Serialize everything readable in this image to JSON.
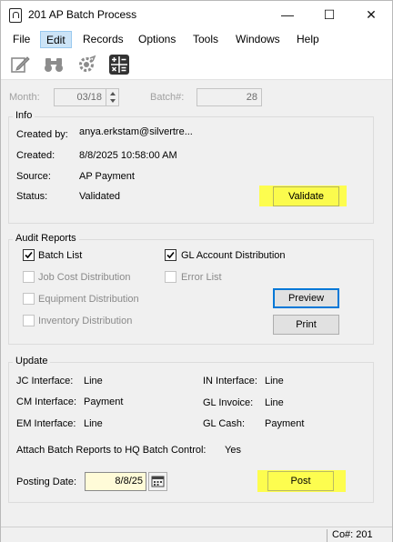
{
  "window": {
    "title": "201 AP Batch Process",
    "minimize": "—",
    "maximize": "☐",
    "close": "✕"
  },
  "menu": [
    "File",
    "Edit",
    "Records",
    "Options",
    "Tools",
    "Windows",
    "Help"
  ],
  "toolbar": {
    "icons": [
      "edit-note-icon",
      "binoculars-icon",
      "gear-icon",
      "calculator-icon"
    ]
  },
  "header": {
    "month_label": "Month:",
    "month_value": "03/18",
    "batch_label": "Batch#:",
    "batch_value": "28"
  },
  "info": {
    "title": "Info",
    "created_by_label": "Created by:",
    "created_by_value": "anya.erkstam@silvertre...",
    "created_label": "Created:",
    "created_value": "8/8/2025 10:58:00 AM",
    "source_label": "Source:",
    "source_value": "AP Payment",
    "status_label": "Status:",
    "status_value": "Validated",
    "validate_button": "Validate"
  },
  "audit": {
    "title": "Audit Reports",
    "batch_list": {
      "label": "Batch List",
      "checked": true
    },
    "gl_account_distribution": {
      "label": "GL Account Distribution",
      "checked": true
    },
    "job_cost_distribution": {
      "label": "Job Cost Distribution",
      "checked": false
    },
    "error_list": {
      "label": "Error List",
      "checked": false
    },
    "equipment_distribution": {
      "label": "Equipment Distribution",
      "checked": false
    },
    "inventory_distribution": {
      "label": "Inventory Distribution",
      "checked": false
    },
    "preview_button": "Preview",
    "print_button": "Print"
  },
  "update": {
    "title": "Update",
    "jc_label": "JC Interface:",
    "jc_value": "Line",
    "in_label": "IN Interface:",
    "in_value": "Line",
    "cm_label": "CM Interface:",
    "cm_value": "Payment",
    "gl_invoice_label": "GL Invoice:",
    "gl_invoice_value": "Line",
    "em_label": "EM Interface:",
    "em_value": "Line",
    "gl_cash_label": "GL Cash:",
    "gl_cash_value": "Payment",
    "attach_label": "Attach Batch Reports to HQ Batch Control:",
    "attach_value": "Yes",
    "posting_date_label": "Posting Date:",
    "posting_date_value": "8/8/25",
    "post_button": "Post"
  },
  "status_bar": {
    "company": "Co#: 201"
  },
  "colors": {
    "highlight": "#ffff33",
    "focus_border": "#0078d7",
    "date_field_bg": "#fffbd8"
  }
}
